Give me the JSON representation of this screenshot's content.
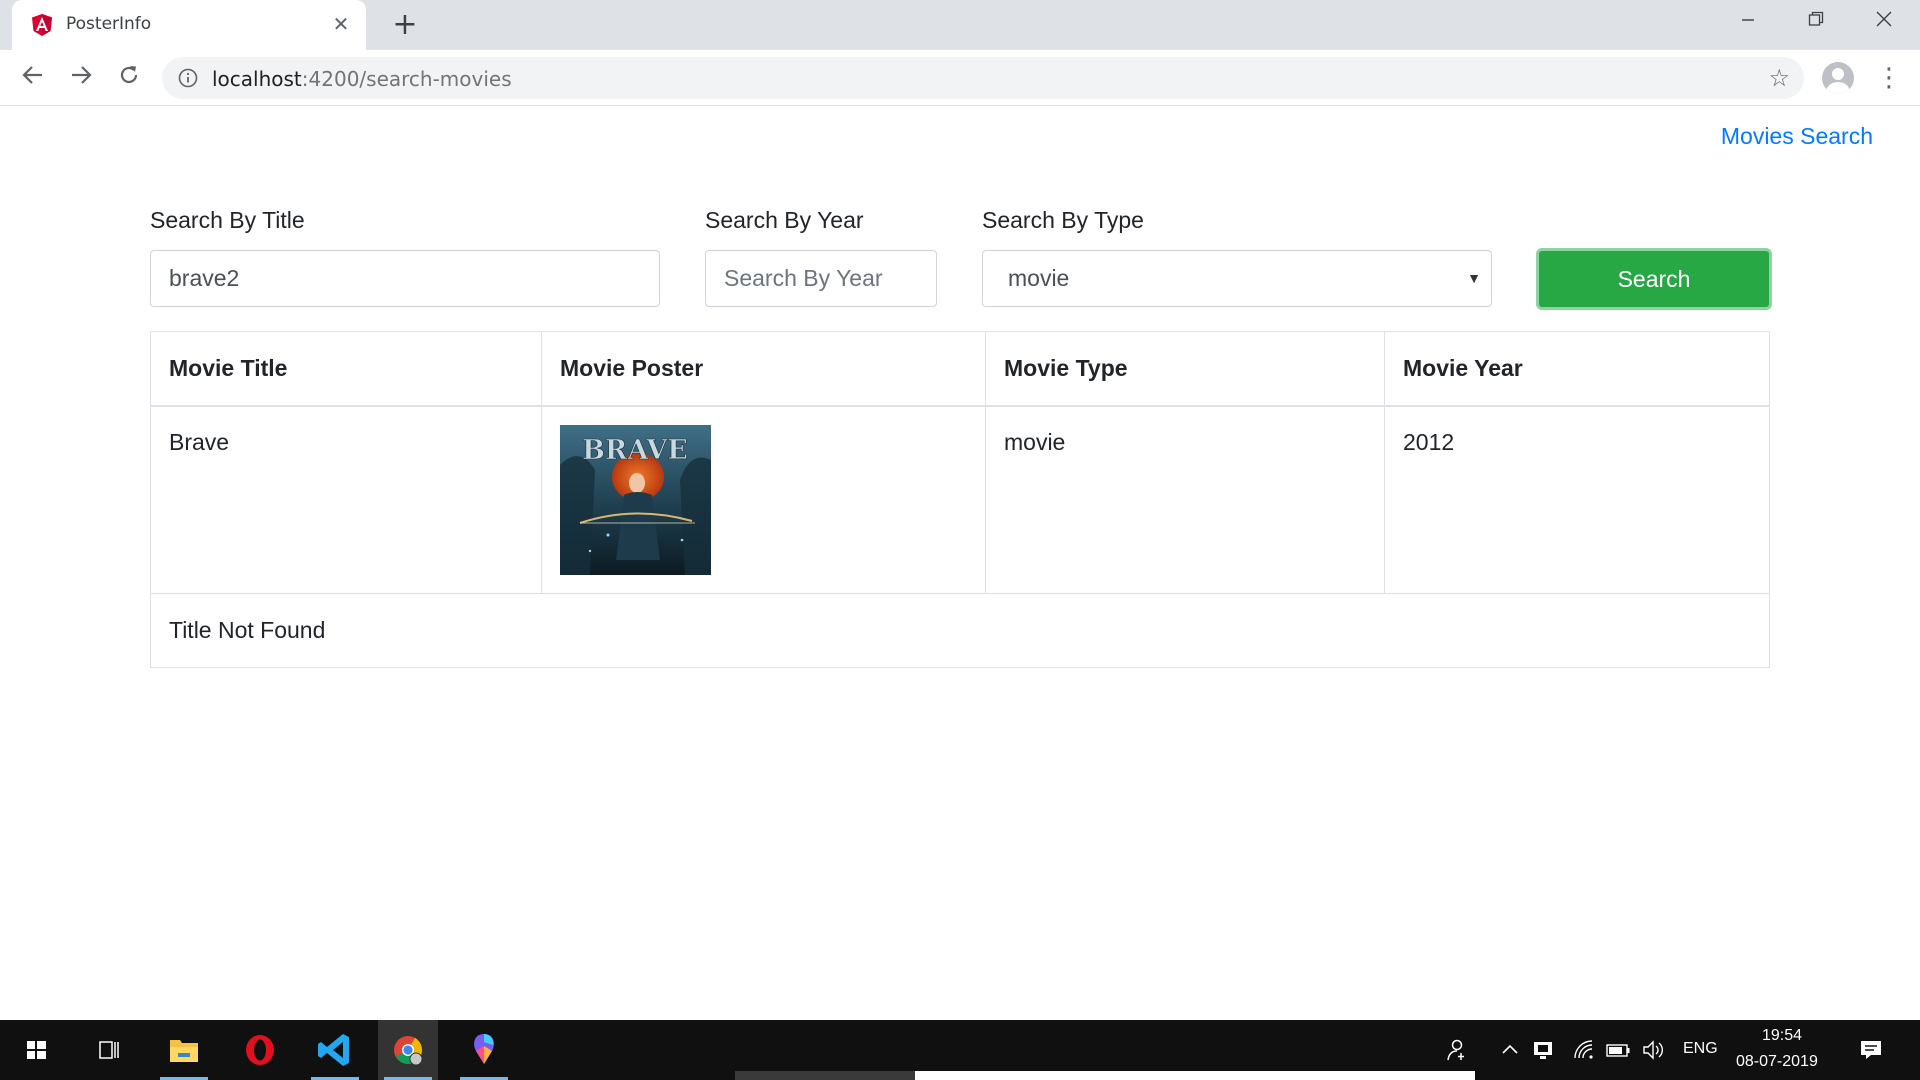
{
  "browser": {
    "tab_title": "PosterInfo",
    "tab_close": "✕",
    "new_tab": "+",
    "url_host": "localhost",
    "url_path": ":4200/search-movies"
  },
  "nav": {
    "link": "Movies Search"
  },
  "search": {
    "title_label": "Search By Title",
    "title_value": "brave2",
    "year_label": "Search By Year",
    "year_placeholder": "Search By Year",
    "type_label": "Search By Type",
    "type_value": "movie",
    "button": "Search"
  },
  "table": {
    "headers": [
      "Movie Title",
      "Movie Poster",
      "Movie Type",
      "Movie Year"
    ],
    "rows": [
      {
        "title": "Brave",
        "poster_text": "BRAVE",
        "type": "movie",
        "year": "2012"
      }
    ],
    "message": "Title Not Found"
  },
  "taskbar": {
    "lang": "ENG",
    "time": "19:54",
    "date": "08-07-2019"
  },
  "colors": {
    "link": "#007bff",
    "success": "#28a745"
  }
}
